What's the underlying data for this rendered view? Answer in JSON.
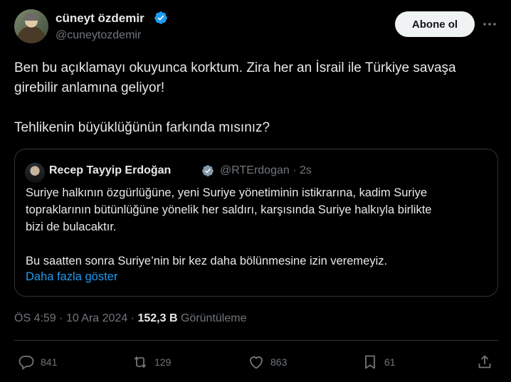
{
  "author": {
    "name": "cüneyt özdemir",
    "handle": "@cuneytozdemir"
  },
  "follow_label": "Abone ol",
  "tweet": {
    "line1": "Ben bu açıklamayı okuyunca korktum. Zira her an İsrail ile Türkiye savaşa",
    "line2": "girebilir anlamına geliyor!",
    "line3": "Tehlikenin büyüklüğünün farkında mısınız?"
  },
  "quote": {
    "name": "Recep Tayyip Erdoğan",
    "handle_time": "@RTErdogan · 2s",
    "para1_l1": "Suriye halkının özgürlüğüne, yeni Suriye yönetiminin istikrarına, kadim Suriye",
    "para1_l2": "topraklarının bütünlüğüne yönelik her saldırı, karşısında Suriye halkıyla birlikte",
    "para1_l3": "bizi de bulacaktır.",
    "para2": "Bu saatten sonra Suriye’nin bir kez daha bölünmesine izin veremeyiz.",
    "show_more": "Daha fazla göster"
  },
  "meta": {
    "time": "ÖS 4:59",
    "date": "10 Ara 2024",
    "views_count": "152,3 B",
    "views_label": "Görüntüleme"
  },
  "actions": {
    "replies": "841",
    "retweets": "129",
    "likes": "863",
    "bookmarks": "61"
  },
  "icons": {
    "verified": "verified-badge-icon",
    "more": "more-icon",
    "reply": "reply-icon",
    "retweet": "retweet-icon",
    "like": "heart-icon",
    "bookmark": "bookmark-icon",
    "share": "share-icon"
  },
  "colors": {
    "background": "#000000",
    "text": "#e7e9ea",
    "muted": "#71767b",
    "link": "#1d9bf0",
    "verified": "#1d9bf0",
    "border": "#2f3336"
  }
}
